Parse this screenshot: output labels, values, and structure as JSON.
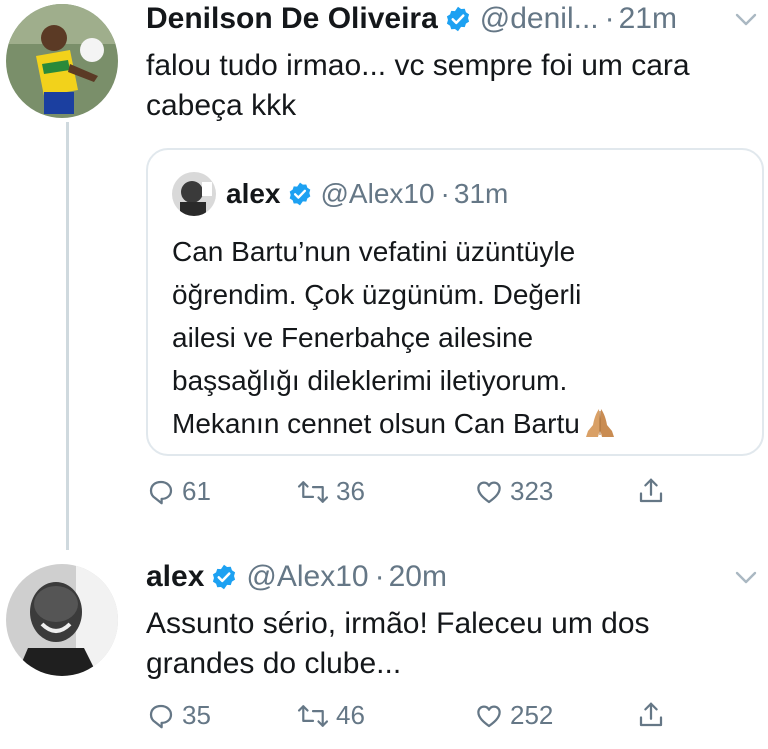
{
  "tweet1": {
    "display_name": "Denilson De Oliveira",
    "handle": "@denil...",
    "separator": "·",
    "time": "21m",
    "text_line1": "falou tudo irmao... vc sempre foi um cara",
    "text_line2": "cabeça kkk"
  },
  "quoted": {
    "display_name": "alex",
    "handle": "@Alex10",
    "separator": "·",
    "time": "31m",
    "lines": [
      "Can Bartu’nun vefatini üzüntüyle",
      "öğrendim. Çok üzgünüm. Değerli",
      "ailesi ve Fenerbahçe ailesine",
      "başsağlığı dileklerimi iletiyorum.",
      "Mekanın cennet olsun Can Bartu"
    ],
    "emoji_icon": "folded-hands-icon"
  },
  "tweet1_actions": {
    "replies": "61",
    "retweets": "36",
    "likes": "323"
  },
  "tweet2": {
    "display_name": "alex",
    "handle": "@Alex10",
    "separator": "·",
    "time": "20m",
    "text_line1": "Assunto sério, irmão! Faleceu um dos",
    "text_line2": "grandes do clube..."
  },
  "tweet2_actions": {
    "replies": "35",
    "retweets": "46",
    "likes": "252"
  },
  "icons": {
    "verified": "verified-badge-icon",
    "more": "chevron-down-icon",
    "reply": "reply-icon",
    "retweet": "retweet-icon",
    "like": "heart-icon",
    "share": "share-icon"
  },
  "colors": {
    "verified_blue": "#1da1f2",
    "secondary_text": "#657786",
    "primary_text": "#14171a",
    "border": "#e1e8ed"
  }
}
